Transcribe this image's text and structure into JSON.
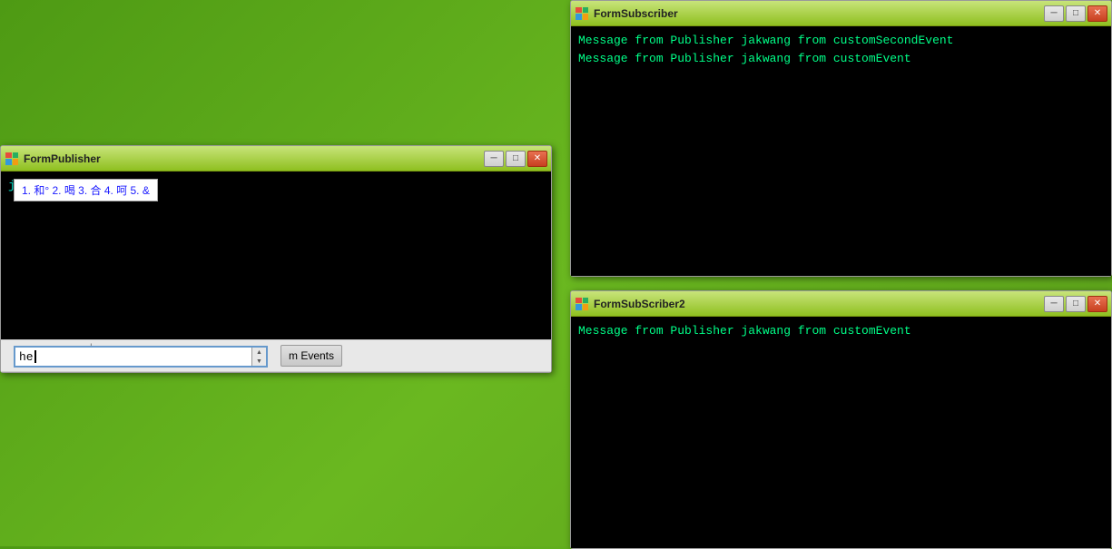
{
  "formPublisher": {
    "title": "FormPublisher",
    "blackContent": "jakwang",
    "inputValue": "he",
    "fireButtonLabel": "m Events",
    "cursorSymbol": "+",
    "imeCandidates": "1. 和° 2. 喝 3. 合 4. 呵 5. &"
  },
  "formSubscriber": {
    "title": "FormSubscriber",
    "line1": "Message from Publisher jakwang from customSecondEvent",
    "line2": "Message from Publisher jakwang from customEvent"
  },
  "formSubscriber2": {
    "title": "FormSubScriber2",
    "line1": "Message from Publisher jakwang from customEvent"
  },
  "titleButtons": {
    "minimize": "─",
    "maximize": "□",
    "close": "✕"
  }
}
